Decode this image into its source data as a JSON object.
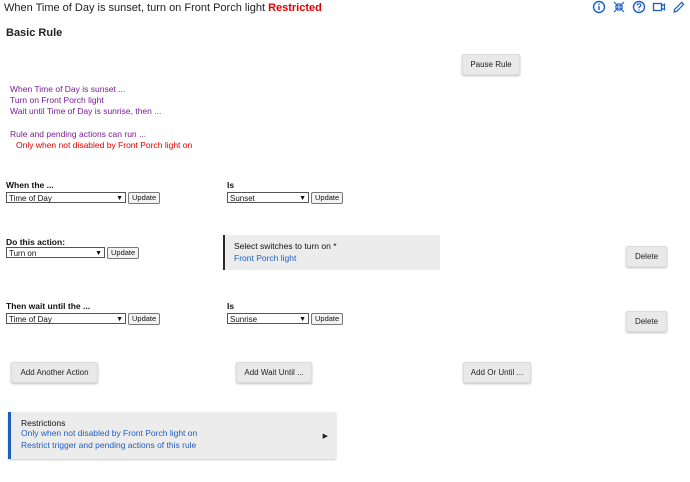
{
  "header": {
    "title": "When Time of Day is sunset, turn on Front Porch light",
    "status": "Restricted",
    "icons": [
      "info-icon",
      "collapse-icon",
      "help-icon",
      "video-icon",
      "edit-icon"
    ]
  },
  "rule_type": "Basic Rule",
  "pause_button": "Pause Rule",
  "summary": {
    "lines": [
      "When Time of Day is sunset ...",
      "Turn on Front Porch light",
      "Wait until Time of Day is sunrise, then ...",
      "Rule and pending actions can run ..."
    ],
    "restriction": "Only when not disabled by Front Porch light on"
  },
  "trigger": {
    "label": "When the ...",
    "select_value": "Time of Day",
    "update_label": "Update",
    "is_label": "Is",
    "is_value": "Sunset"
  },
  "action": {
    "label": "Do this action:",
    "select_value": "Turn on",
    "update_label": "Update",
    "switch_title": "Select switches to turn on *",
    "switch_value": "Front Porch light",
    "delete_label": "Delete"
  },
  "wait": {
    "label": "Then wait until the ...",
    "select_value": "Time of Day",
    "update_label": "Update",
    "is_label": "Is",
    "is_value": "Sunrise",
    "delete_label": "Delete"
  },
  "buttons": {
    "add_action": "Add Another Action",
    "add_wait": "Add Wait Until ...",
    "add_or": "Add Or Until ..."
  },
  "restrictions": {
    "title": "Restrictions",
    "line1": "Only when not disabled by Front Porch light on",
    "line2": "Restrict trigger and pending actions of this rule"
  },
  "colors": {
    "summary": "#7a1b9a",
    "restricted": "#e00000",
    "link": "#1f5fbf",
    "icon": "#1a5fc0"
  }
}
